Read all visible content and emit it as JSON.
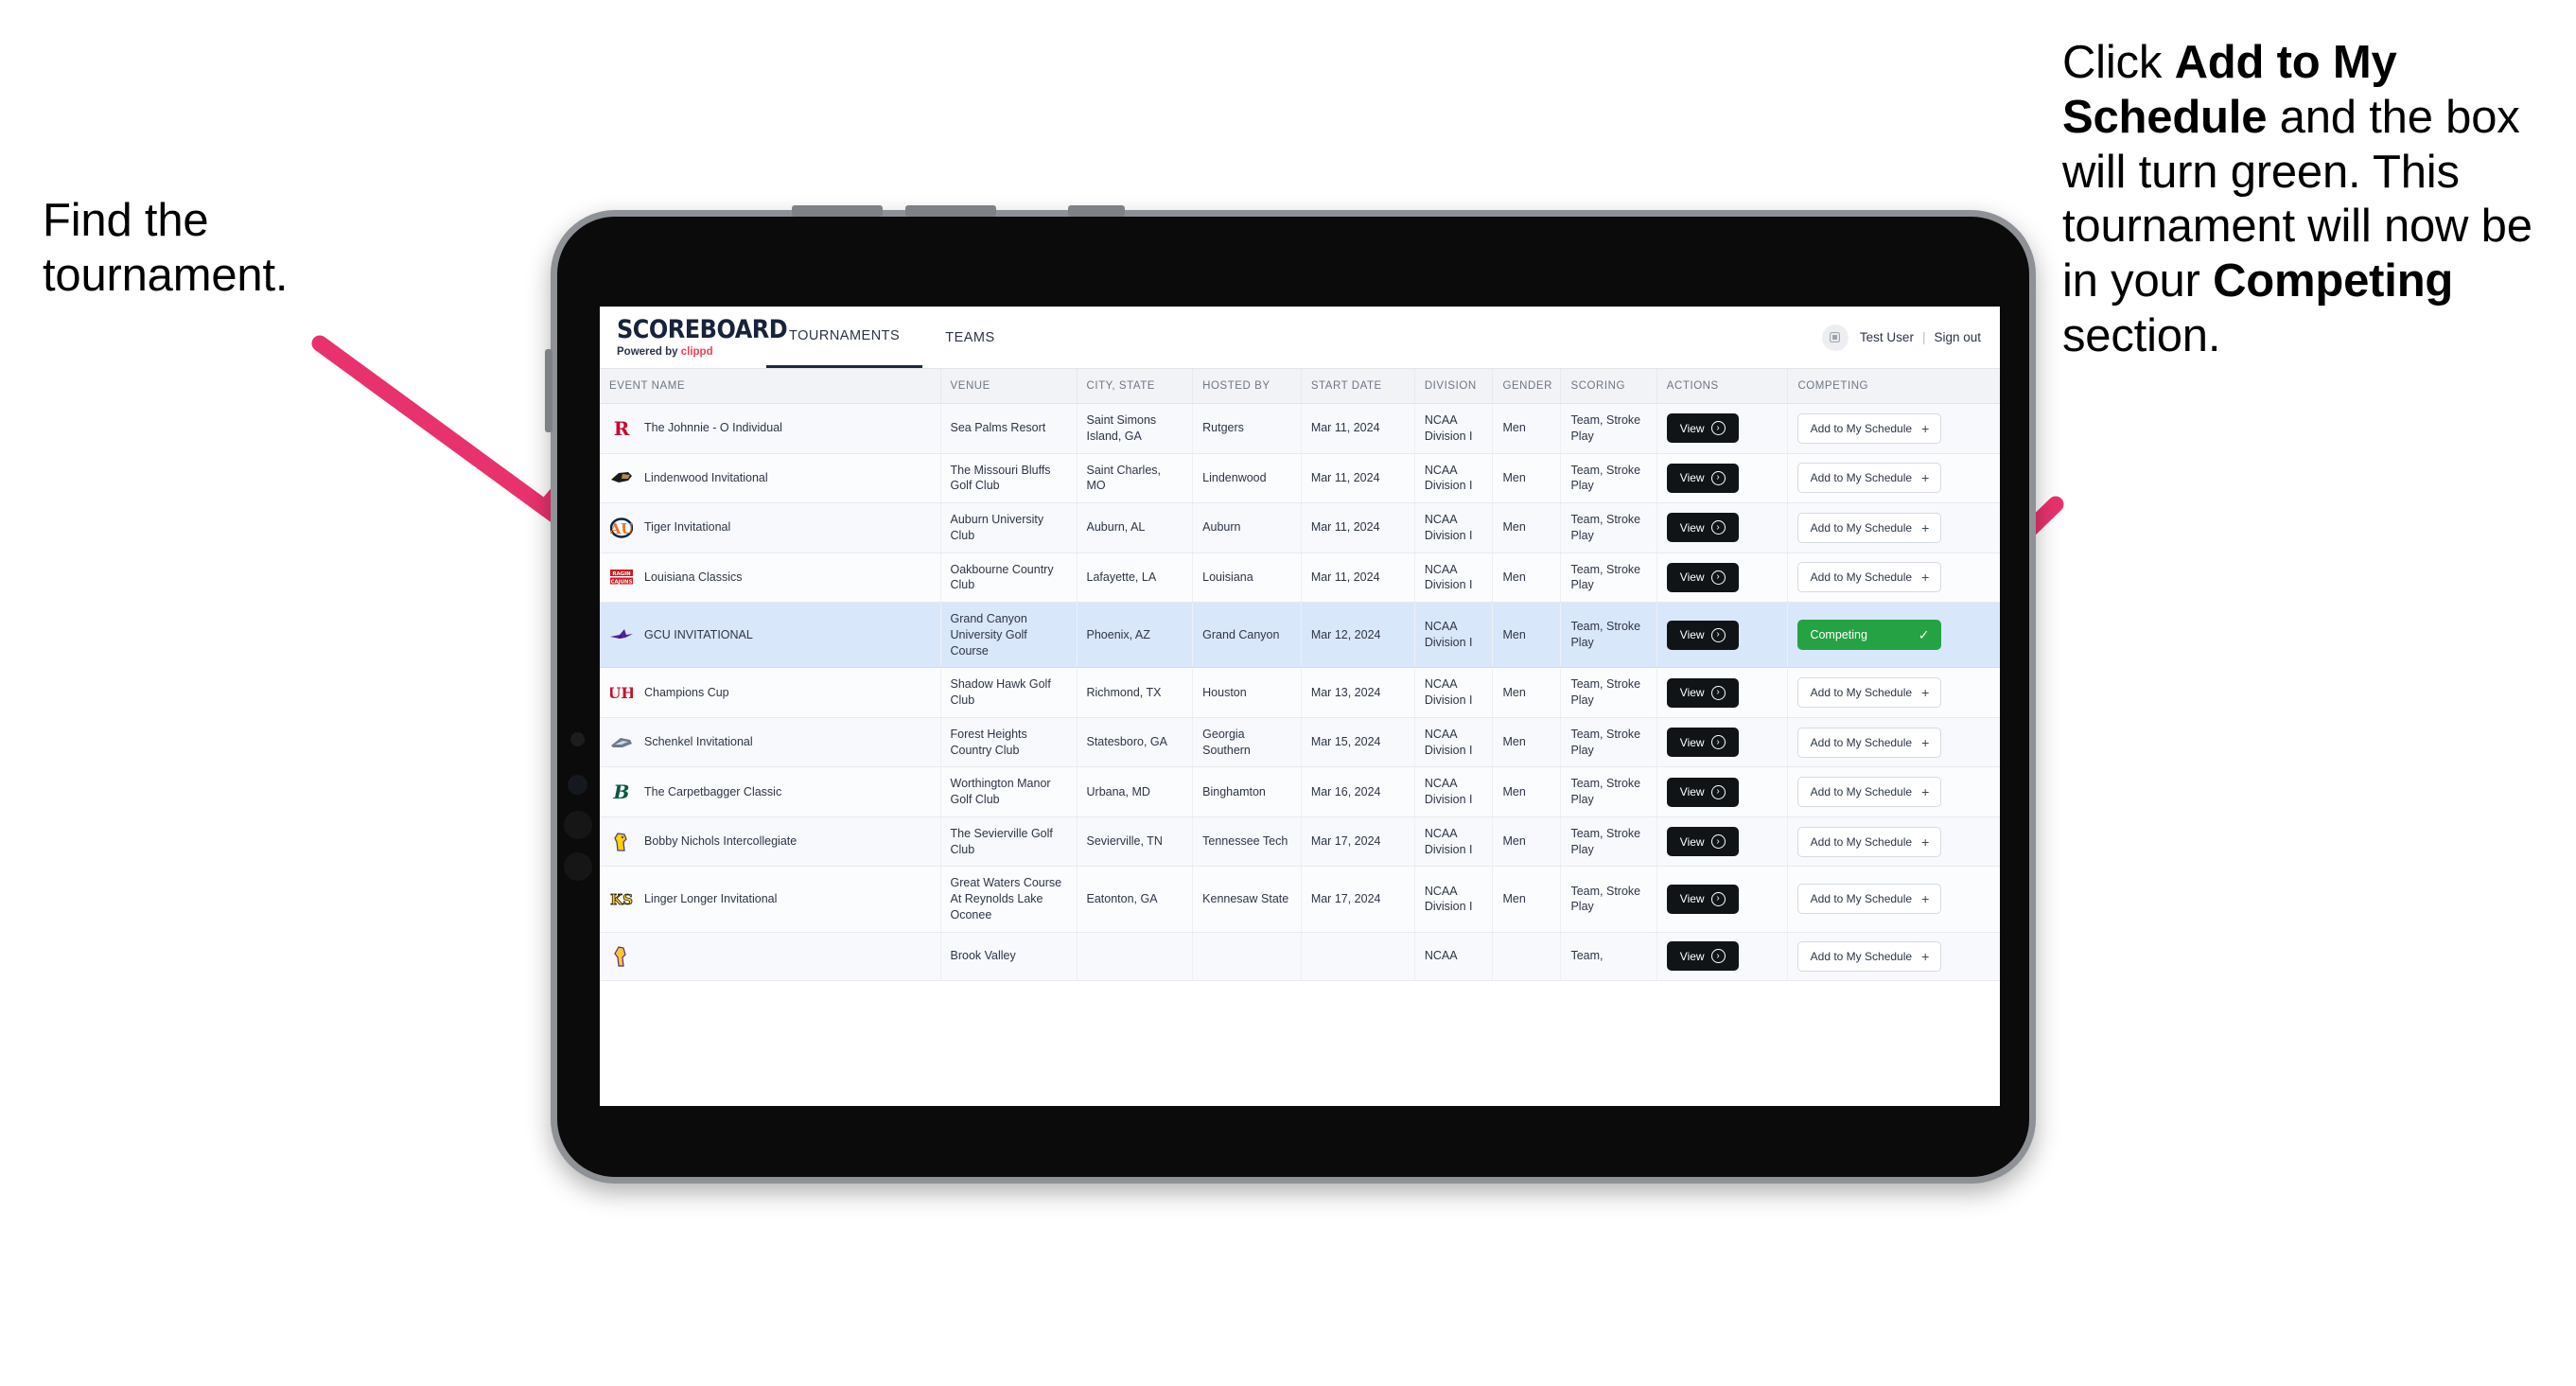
{
  "annotations": {
    "left": {
      "line1": "Find the",
      "line2": "tournament."
    },
    "right": {
      "t1": "Click ",
      "b1": "Add to My Schedule",
      "t2": " and the box will turn green. This tournament will now be in your ",
      "b2": "Competing",
      "t3": " section."
    },
    "arrow_color": "#e8326d"
  },
  "app": {
    "brand": {
      "name": "SCOREBOARD",
      "tagline_prefix": "Powered by ",
      "tagline_brand": "clippd"
    },
    "nav": [
      {
        "label": "TOURNAMENTS",
        "active": true
      },
      {
        "label": "TEAMS",
        "active": false
      }
    ],
    "user": {
      "avatar_icon": "user-avatar-icon",
      "name": "Test User",
      "separator": "|",
      "sign_out": "Sign out"
    },
    "table": {
      "columns": [
        "EVENT NAME",
        "VENUE",
        "CITY, STATE",
        "HOSTED BY",
        "START DATE",
        "DIVISION",
        "GENDER",
        "SCORING",
        "ACTIONS",
        "COMPETING"
      ],
      "view_label": "View",
      "add_label": "Add to My Schedule",
      "add_plus": "+",
      "competing_label": "Competing",
      "competing_check": "✓",
      "competing_color": "#25a244",
      "highlight_color": "#d9e7fb",
      "rows": [
        {
          "logo": "rutgers-logo",
          "event": "The Johnnie - O Individual",
          "venue": "Sea Palms Resort",
          "city": "Saint Simons Island, GA",
          "host": "Rutgers",
          "date": "Mar 11, 2024",
          "division": "NCAA Division I",
          "gender": "Men",
          "scoring": "Team, Stroke Play",
          "competing": false
        },
        {
          "logo": "lindenwood-logo",
          "event": "Lindenwood Invitational",
          "venue": "The Missouri Bluffs Golf Club",
          "city": "Saint Charles, MO",
          "host": "Lindenwood",
          "date": "Mar 11, 2024",
          "division": "NCAA Division I",
          "gender": "Men",
          "scoring": "Team, Stroke Play",
          "competing": false
        },
        {
          "logo": "auburn-logo",
          "event": "Tiger Invitational",
          "venue": "Auburn University Club",
          "city": "Auburn, AL",
          "host": "Auburn",
          "date": "Mar 11, 2024",
          "division": "NCAA Division I",
          "gender": "Men",
          "scoring": "Team, Stroke Play",
          "competing": false
        },
        {
          "logo": "louisiana-logo",
          "event": "Louisiana Classics",
          "venue": "Oakbourne Country Club",
          "city": "Lafayette, LA",
          "host": "Louisiana",
          "date": "Mar 11, 2024",
          "division": "NCAA Division I",
          "gender": "Men",
          "scoring": "Team, Stroke Play",
          "competing": false
        },
        {
          "logo": "gcu-logo",
          "event": "GCU INVITATIONAL",
          "venue": "Grand Canyon University Golf Course",
          "city": "Phoenix, AZ",
          "host": "Grand Canyon",
          "date": "Mar 12, 2024",
          "division": "NCAA Division I",
          "gender": "Men",
          "scoring": "Team, Stroke Play",
          "competing": true
        },
        {
          "logo": "houston-logo",
          "event": "Champions Cup",
          "venue": "Shadow Hawk Golf Club",
          "city": "Richmond, TX",
          "host": "Houston",
          "date": "Mar 13, 2024",
          "division": "NCAA Division I",
          "gender": "Men",
          "scoring": "Team, Stroke Play",
          "competing": false
        },
        {
          "logo": "georgia-southern-logo",
          "event": "Schenkel Invitational",
          "venue": "Forest Heights Country Club",
          "city": "Statesboro, GA",
          "host": "Georgia Southern",
          "date": "Mar 15, 2024",
          "division": "NCAA Division I",
          "gender": "Men",
          "scoring": "Team, Stroke Play",
          "competing": false
        },
        {
          "logo": "binghamton-logo",
          "event": "The Carpetbagger Classic",
          "venue": "Worthington Manor Golf Club",
          "city": "Urbana, MD",
          "host": "Binghamton",
          "date": "Mar 16, 2024",
          "division": "NCAA Division I",
          "gender": "Men",
          "scoring": "Team, Stroke Play",
          "competing": false
        },
        {
          "logo": "tennessee-tech-logo",
          "event": "Bobby Nichols Intercollegiate",
          "venue": "The Sevierville Golf Club",
          "city": "Sevierville, TN",
          "host": "Tennessee Tech",
          "date": "Mar 17, 2024",
          "division": "NCAA Division I",
          "gender": "Men",
          "scoring": "Team, Stroke Play",
          "competing": false
        },
        {
          "logo": "kennesaw-state-logo",
          "event": "Linger Longer Invitational",
          "venue": "Great Waters Course At Reynolds Lake Oconee",
          "city": "Eatonton, GA",
          "host": "Kennesaw State",
          "date": "Mar 17, 2024",
          "division": "NCAA Division I",
          "gender": "Men",
          "scoring": "Team, Stroke Play",
          "competing": false
        },
        {
          "logo": "ecu-logo",
          "event": "",
          "venue": "Brook Valley",
          "city": "",
          "host": "",
          "date": "",
          "division": "NCAA",
          "gender": "",
          "scoring": "Team,",
          "competing": false,
          "clipped": true
        }
      ]
    }
  }
}
